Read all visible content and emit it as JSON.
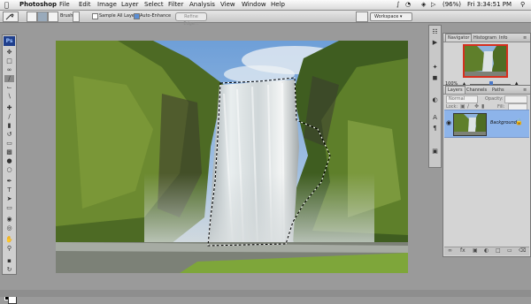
{
  "menubar": {
    "apple": "",
    "app": "Photoshop",
    "menus": [
      "File",
      "Edit",
      "Image",
      "Layer",
      "Select",
      "Filter",
      "Analysis",
      "View",
      "Window",
      "Help"
    ],
    "battery": "(96%)",
    "clock": "Fri 3:34:51 PM"
  },
  "options": {
    "brush_label": "Brush:",
    "sample_all_layers": "Sample All Layers",
    "auto_enhance": "Auto-Enhance",
    "refine_edge": "Refine Edge...",
    "workspace": "Workspace"
  },
  "toolbox": {
    "logo": "Ps"
  },
  "navigator": {
    "tabs": [
      "Navigator",
      "Histogram",
      "Info"
    ],
    "zoom": "100%"
  },
  "layers": {
    "tabs": [
      "Layers",
      "Channels",
      "Paths"
    ],
    "blend_mode": "Normal",
    "opacity_label": "Opacity:",
    "lock_label": "Lock:",
    "fill_label": "Fill:",
    "layer_name": "Background"
  },
  "colors": {
    "accent": "#1f3f8c",
    "selected_layer": "#8db4ea",
    "navigator_frame": "#d62f1f"
  }
}
